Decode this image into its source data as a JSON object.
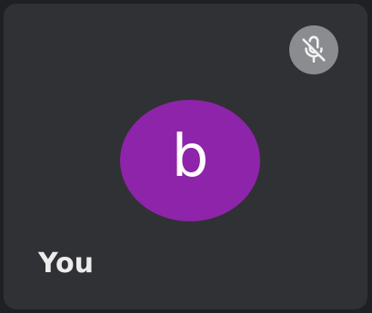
{
  "participant": {
    "name": "You",
    "avatar_initial": "b",
    "avatar_color": "#8e24aa",
    "tile_color": "#303134"
  },
  "mic": {
    "state": "muted",
    "icon": "mic-off-icon",
    "badge_color": "#8a8c90"
  }
}
